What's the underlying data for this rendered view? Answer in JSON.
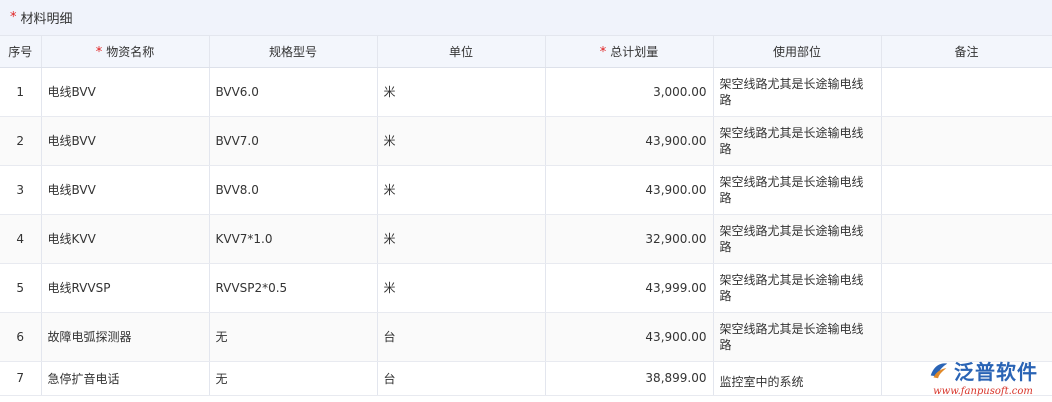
{
  "section": {
    "required_mark": "*",
    "title": "材料明细"
  },
  "table": {
    "columns": [
      {
        "label": "序号",
        "required": false
      },
      {
        "label": "物资名称",
        "required": true
      },
      {
        "label": "规格型号",
        "required": false
      },
      {
        "label": "单位",
        "required": false
      },
      {
        "label": "总计划量",
        "required": true
      },
      {
        "label": "使用部位",
        "required": false
      },
      {
        "label": "备注",
        "required": false
      }
    ],
    "rows": [
      {
        "index": "1",
        "name": "电线BVV",
        "spec": "BVV6.0",
        "unit": "米",
        "plan": "3,000.00",
        "dept": "架空线路尤其是长途输电线路",
        "note": ""
      },
      {
        "index": "2",
        "name": "电线BVV",
        "spec": "BVV7.0",
        "unit": "米",
        "plan": "43,900.00",
        "dept": "架空线路尤其是长途输电线路",
        "note": ""
      },
      {
        "index": "3",
        "name": "电线BVV",
        "spec": "BVV8.0",
        "unit": "米",
        "plan": "43,900.00",
        "dept": "架空线路尤其是长途输电线路",
        "note": ""
      },
      {
        "index": "4",
        "name": "电线KVV",
        "spec": "KVV7*1.0",
        "unit": "米",
        "plan": "32,900.00",
        "dept": "架空线路尤其是长途输电线路",
        "note": ""
      },
      {
        "index": "5",
        "name": "电线RVVSP",
        "spec": "RVVSP2*0.5",
        "unit": "米",
        "plan": "43,999.00",
        "dept": "架空线路尤其是长途输电线路",
        "note": ""
      },
      {
        "index": "6",
        "name": "故障电弧探测器",
        "spec": "无",
        "unit": "台",
        "plan": "43,900.00",
        "dept": "架空线路尤其是长途输电线路",
        "note": ""
      },
      {
        "index": "7",
        "name": "急停扩音电话",
        "spec": "无",
        "unit": "台",
        "plan": "38,899.00",
        "dept": "监控室中的系统",
        "note": ""
      }
    ]
  },
  "watermark": {
    "name": "泛普软件",
    "url": "www.fanpusoft.com",
    "logo_icon": "fanpu-logo-icon",
    "colors": {
      "brand": "#2a64b5",
      "url": "#d8362b"
    }
  }
}
